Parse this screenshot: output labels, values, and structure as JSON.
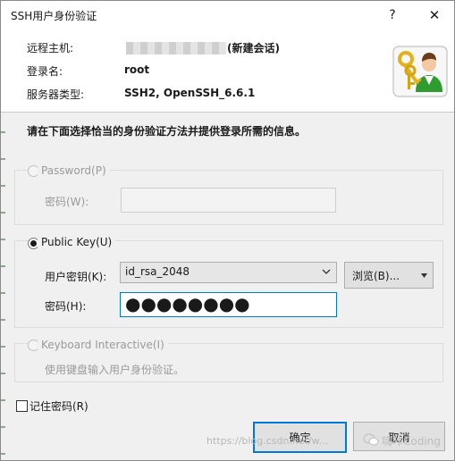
{
  "window": {
    "title": "SSH用户身份验证",
    "help_glyph": "?",
    "close_glyph": "✕"
  },
  "info": {
    "remote_host_label": "远程主机:",
    "remote_host_suffix": "(新建会话)",
    "login_label": "登录名:",
    "login_value": "root",
    "server_type_label": "服务器类型:",
    "server_type_value": "SSH2, OpenSSH_6.6.1"
  },
  "instructions": "请在下面选择恰当的身份验证方法并提供登录所需的信息。",
  "password_group": {
    "label": "Password(P)",
    "selected": false,
    "enabled": false,
    "password_label": "密码(W):",
    "password_value": ""
  },
  "publickey_group": {
    "label": "Public Key(U)",
    "selected": true,
    "enabled": true,
    "user_key_label": "用户密钥(K):",
    "user_key_value": "id_rsa_2048",
    "browse_label": "浏览(B)...",
    "passphrase_label": "密码(H):",
    "passphrase_value": "●●●●●●●●"
  },
  "keyboard_group": {
    "label": "Keyboard Interactive(I)",
    "selected": false,
    "enabled": false,
    "description": "使用键盘输入用户身份验证。"
  },
  "remember_password": {
    "label": "记住密码(R)",
    "checked": false
  },
  "buttons": {
    "ok": "确定",
    "cancel": "取消"
  },
  "watermarks": {
    "url": "https://blog.csdn.net/w...",
    "brand": "嗨咔Coding"
  },
  "icons": {
    "dropdown": "chevron-down-icon",
    "keys": "user-key-icon",
    "watermark": "wechat-icon"
  },
  "colors": {
    "accent": "#0078d7",
    "key_gold": "#e3b21a",
    "user_green": "#2f9c2f"
  }
}
